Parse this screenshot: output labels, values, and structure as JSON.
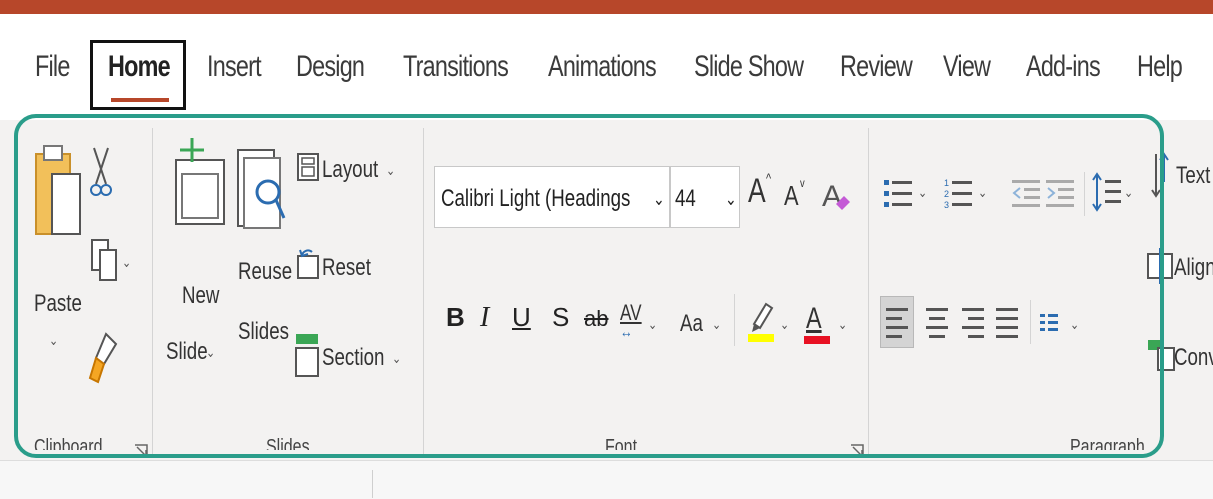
{
  "tabs": [
    {
      "label": "File"
    },
    {
      "label": "Home"
    },
    {
      "label": "Insert"
    },
    {
      "label": "Design"
    },
    {
      "label": "Transitions"
    },
    {
      "label": "Animations"
    },
    {
      "label": "Slide Show"
    },
    {
      "label": "Review"
    },
    {
      "label": "View"
    },
    {
      "label": "Add-ins"
    },
    {
      "label": "Help"
    }
  ],
  "active_tab": "Home",
  "clipboard": {
    "paste_label": "Paste",
    "group_label": "Clipboard"
  },
  "slides": {
    "new_slide_line1": "New",
    "new_slide_line2": "Slide",
    "reuse_line1": "Reuse",
    "reuse_line2": "Slides",
    "layout_label": "Layout",
    "reset_label": "Reset",
    "section_label": "Section",
    "group_label": "Slides"
  },
  "font": {
    "font_name": "Calibri Light (Headings",
    "font_size": "44",
    "bold": "B",
    "italic": "I",
    "underline": "U",
    "shadow": "S",
    "strike": "ab",
    "spacing": "AV",
    "change_case": "Aa",
    "font_color_letter": "A",
    "grow": "A",
    "shrink": "A",
    "group_label": "Font"
  },
  "paragraph": {
    "group_label": "Paragraph"
  },
  "overflow": {
    "text_label": "Text",
    "align_label": "Align",
    "convert_label": "Conv"
  },
  "colors": {
    "accent": "#b7472a",
    "highlight_border": "#2a9d8a",
    "highlight_color": "#ffff00",
    "font_color": "#e81123"
  }
}
